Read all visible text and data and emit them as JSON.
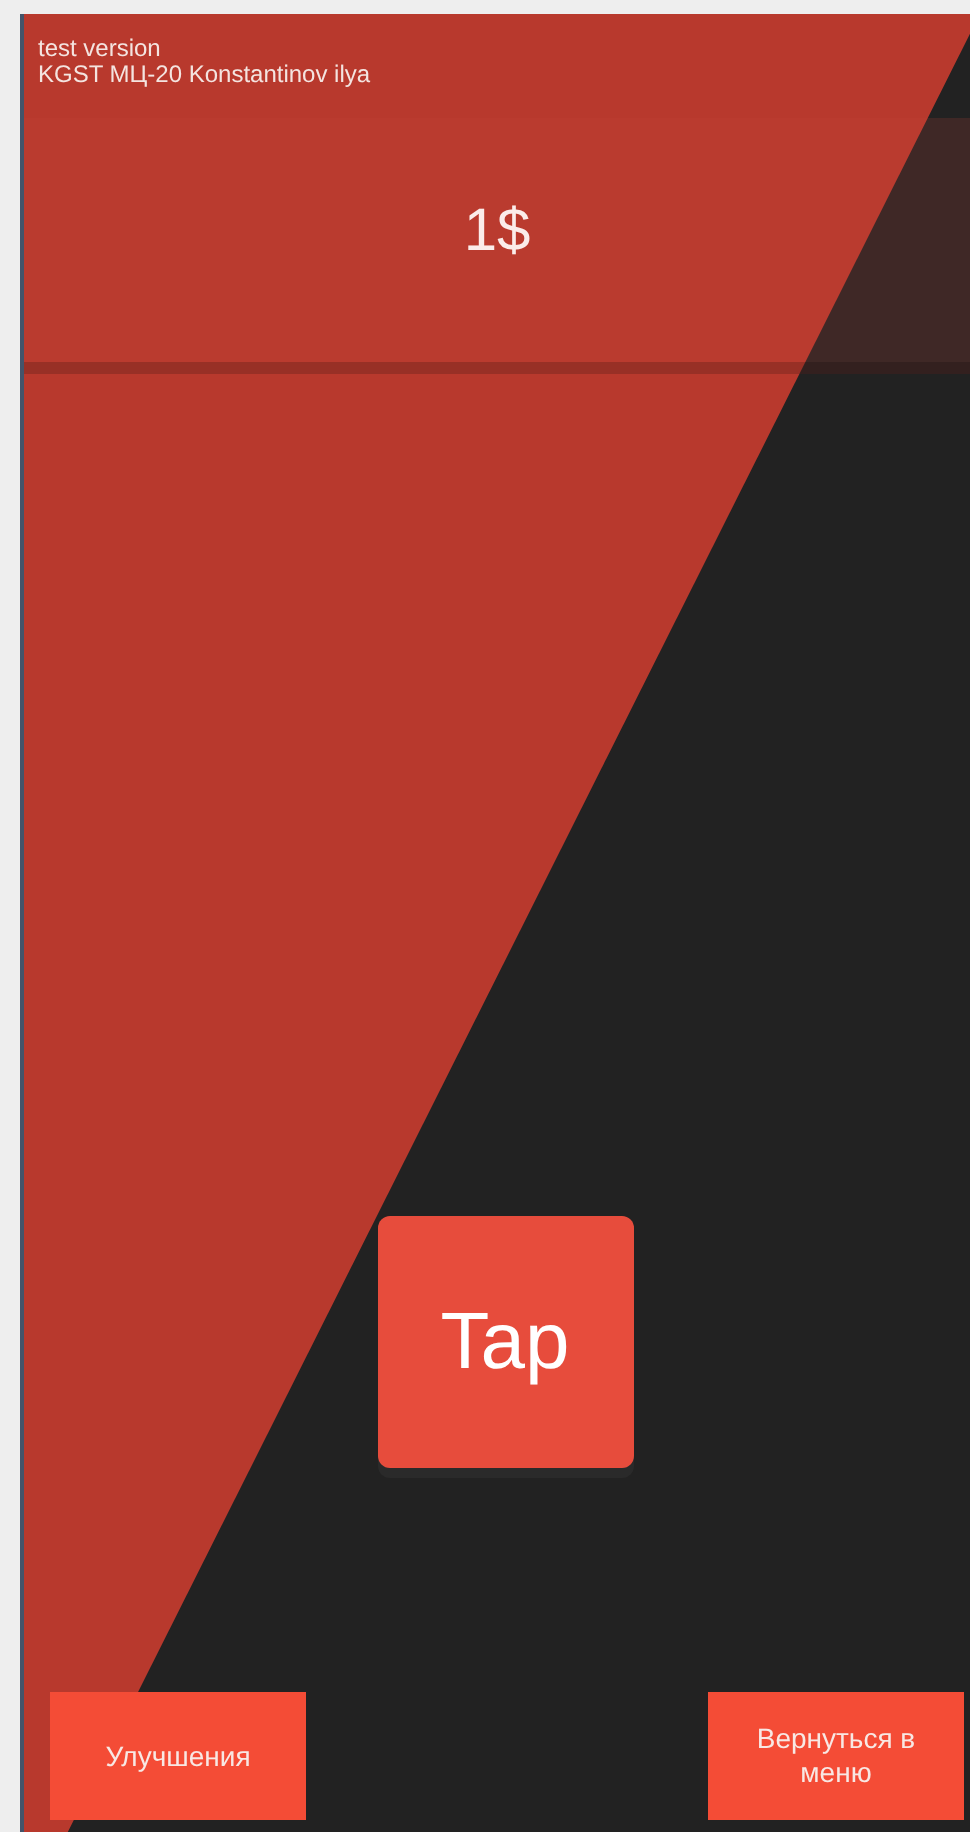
{
  "info_lines": [
    "test version",
    "KGST МЦ-20 Konstantinov ilya"
  ],
  "balance": "1$",
  "tap_button": "Tap",
  "buttons": [
    "Улучшения",
    "Вернуться в меню"
  ]
}
